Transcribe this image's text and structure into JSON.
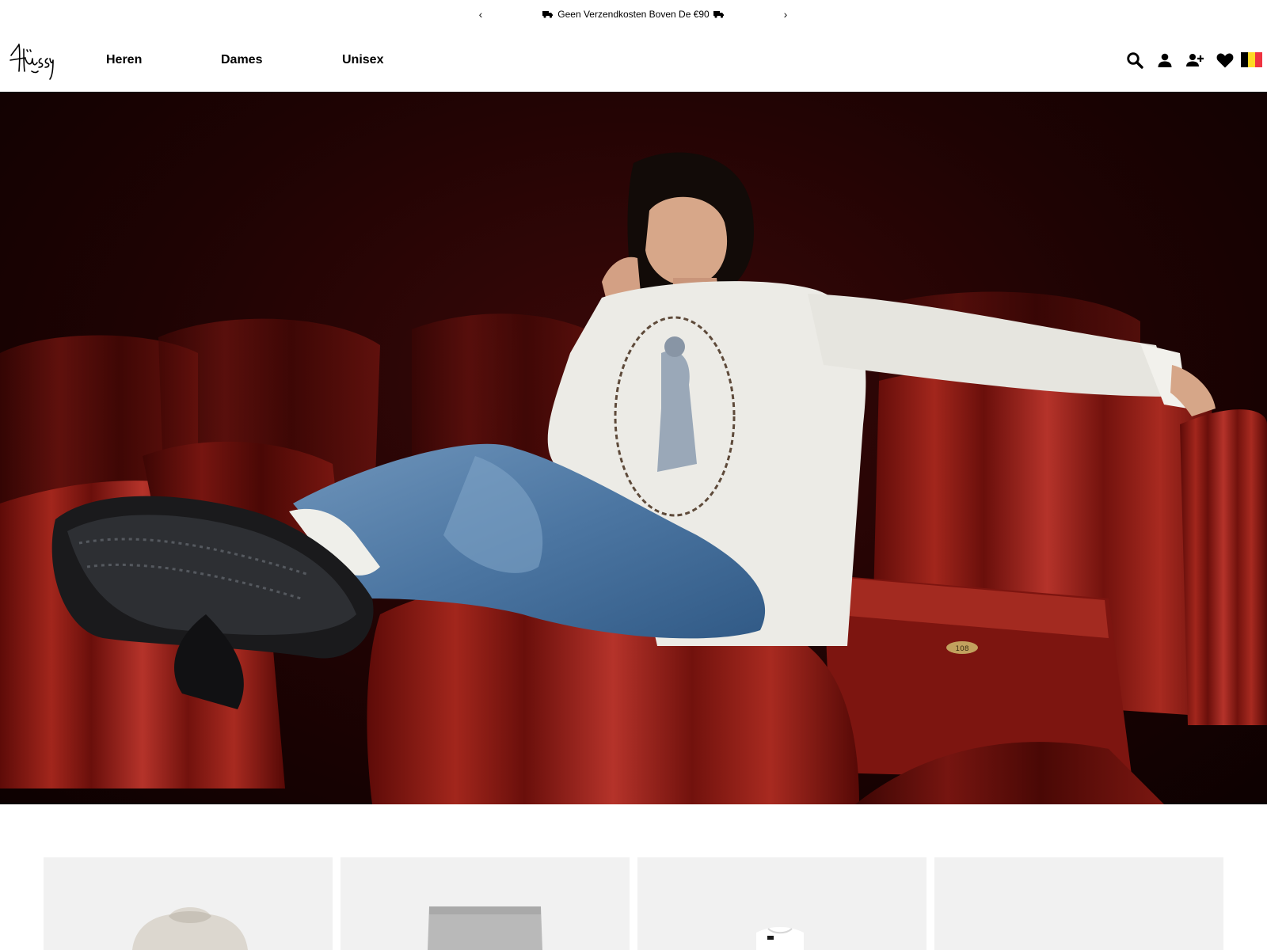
{
  "announcement": {
    "message": "Geen Verzendkosten Boven De €90",
    "prev_arrow": "‹",
    "next_arrow": "›",
    "icon": "truck-icon"
  },
  "header": {
    "logo_text": "Stüssy",
    "nav": [
      {
        "label": "Heren"
      },
      {
        "label": "Dames"
      },
      {
        "label": "Unisex"
      }
    ],
    "icons": [
      "search-icon",
      "account-icon",
      "register-icon",
      "wishlist-heart-icon",
      "country-flag-belgium-icon"
    ]
  },
  "hero": {
    "image_alt": "Model in white graphic long sleeve and denim jeans seated in red velvet theatre seats",
    "seat_number": "108"
  },
  "products": [
    {
      "image_alt": "Hoodie"
    },
    {
      "image_alt": "Sweatpants"
    },
    {
      "image_alt": "T-shirt"
    },
    {
      "image_alt": "Product"
    }
  ],
  "colors": {
    "flag_black": "#000000",
    "flag_yellow": "#FDDA24",
    "flag_red": "#EF3340",
    "seat_red": "#8e1712",
    "card_bg": "#f1f1f1"
  }
}
